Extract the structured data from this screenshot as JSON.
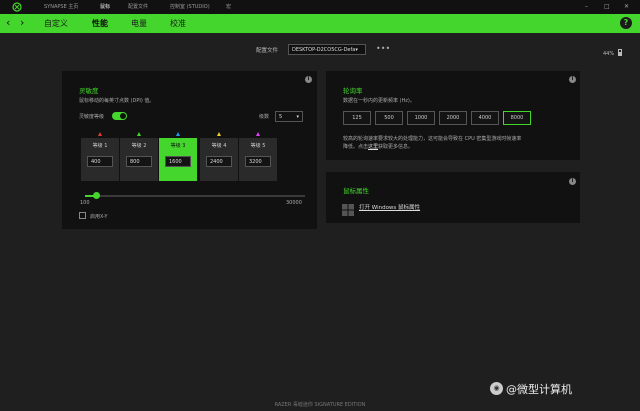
{
  "topbar": {
    "nav": [
      "SYNAPSE 主页",
      "鼠标",
      "配置文件",
      "控制室 (STUDIO)",
      "宏"
    ],
    "active_index": 1,
    "window_controls": [
      "–",
      "□",
      "✕"
    ]
  },
  "tabs": {
    "items": [
      "自定义",
      "性能",
      "电量",
      "校准"
    ],
    "active_index": 1,
    "help": "?"
  },
  "profile": {
    "label": "配置文件",
    "value": "DESKTOP-D2CO5CG-Defa▾",
    "more": "•••"
  },
  "battery": {
    "percent": "44%",
    "level": 0.44
  },
  "sensitivity": {
    "title": "灵敏度",
    "desc": "鼠标移动的每英寸点数 (DPI) 值。",
    "toggle_label": "灵敏度等级",
    "toggle_on": true,
    "stages_label": "级数",
    "stages_value": "5",
    "stages": [
      {
        "label": "等级 1",
        "value": "400"
      },
      {
        "label": "等级 2",
        "value": "800"
      },
      {
        "label": "等级 3",
        "value": "1600"
      },
      {
        "label": "等级 4",
        "value": "2400"
      },
      {
        "label": "等级 5",
        "value": "3200"
      }
    ],
    "active_stage": 2,
    "marker_colors": [
      "#e53935",
      "#44d62c",
      "#2196f3",
      "#e8d033",
      "#e040fb"
    ],
    "slider": {
      "min": "100",
      "max": "30000",
      "value": 1600
    },
    "xy_label": "启用X-Y"
  },
  "polling": {
    "title": "轮询率",
    "desc": "数据在一秒内的更新频率 (Hz)。",
    "rates": [
      "125",
      "500",
      "1000",
      "2000",
      "4000",
      "8000"
    ],
    "active_rate_index": 5,
    "note1": "较高的轮询速率要求较大的处理能力，这可能会导致在 CPU 密集型游戏时帧速率",
    "note2": "降低。点击",
    "note_link": "这里",
    "note3": "获取更多信息。"
  },
  "mouse_props": {
    "title": "鼠标属性",
    "link": "打开 Windows 鼠标属性"
  },
  "footer": {
    "device": "RAZER 毒蝰迷你 SIGNATURE EDITION"
  },
  "watermark": {
    "text": "@微型计算机",
    "icon": "weibo-icon"
  }
}
